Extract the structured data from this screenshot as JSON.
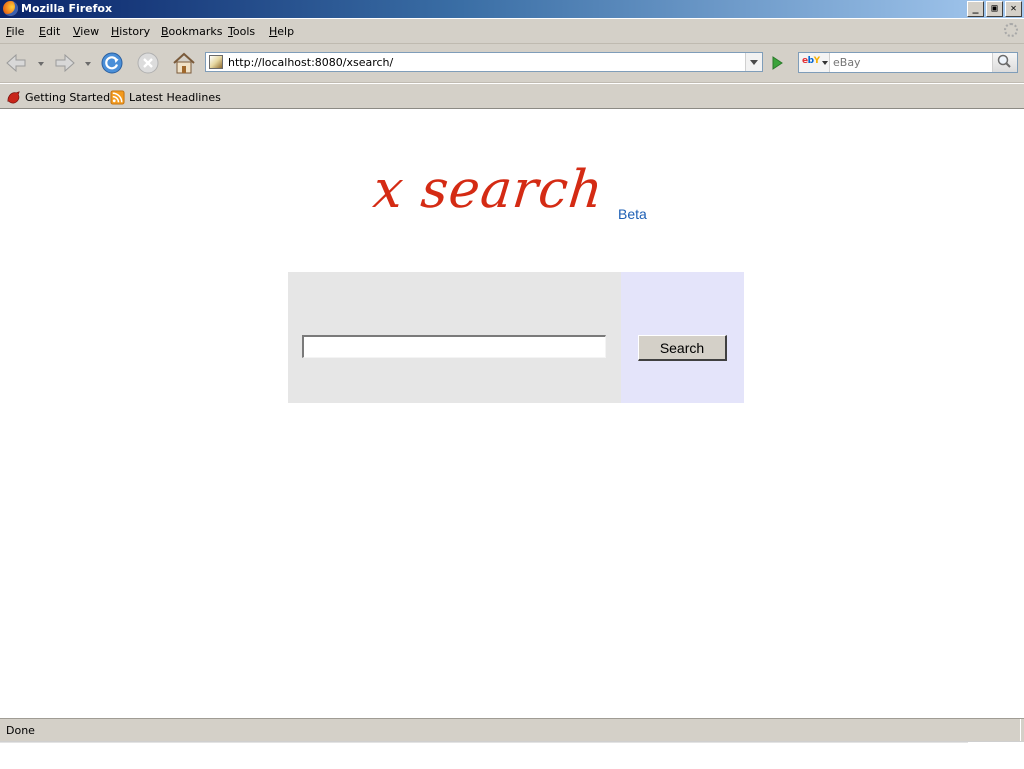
{
  "window": {
    "title": "Mozilla Firefox",
    "minimize_label": "_",
    "maximize_label": "▣",
    "close_label": "✕"
  },
  "menu": {
    "file": {
      "accel": "F",
      "rest": "ile"
    },
    "edit": {
      "accel": "E",
      "rest": "dit"
    },
    "view": {
      "accel": "V",
      "rest": "iew"
    },
    "history": {
      "accel": "H",
      "rest": "istory"
    },
    "bookmarks": {
      "accel": "B",
      "rest": "ookmarks"
    },
    "tools": {
      "accel": "T",
      "rest": "ools"
    },
    "help": {
      "accel": "H",
      "rest": "elp"
    }
  },
  "navbar": {
    "url": "http://localhost:8080/xsearch/",
    "search_engine_label": "ebY",
    "search_placeholder": "eBay",
    "icons": {
      "back": "back-arrow-icon",
      "forward": "forward-arrow-icon",
      "reload": "reload-icon",
      "stop": "stop-icon",
      "home": "home-icon",
      "go": "go-arrow-icon",
      "search": "magnifier-icon"
    }
  },
  "bookmarks": {
    "items": [
      {
        "label": "Getting Started",
        "icon": "firefox-bookmark-icon"
      },
      {
        "label": "Latest Headlines",
        "icon": "rss-feed-icon"
      }
    ]
  },
  "page": {
    "logo": "x search",
    "beta": "Beta",
    "query_value": "",
    "search_button": "Search"
  },
  "status": {
    "text": "Done"
  },
  "colors": {
    "logo": "#d42b14",
    "beta": "#1d5fb5",
    "panel_left": "#e6e6e6",
    "panel_right": "#e4e4fa",
    "chrome": "#d4d0c8"
  }
}
